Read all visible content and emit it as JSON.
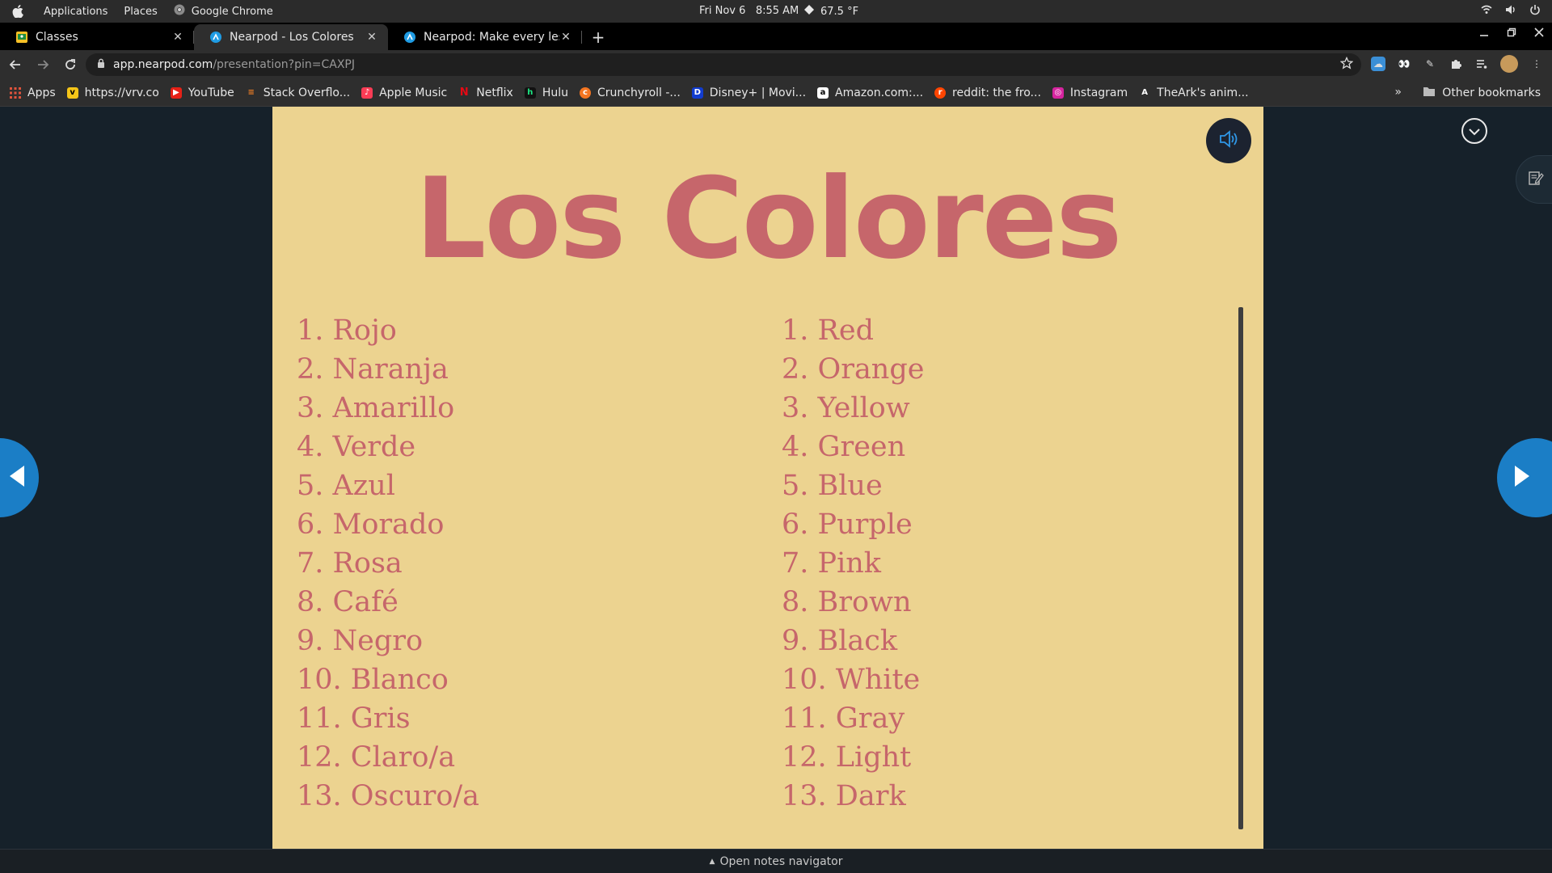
{
  "system_bar": {
    "menus": [
      "Applications",
      "Places"
    ],
    "active_app": "Google Chrome",
    "date": "Fri Nov 6",
    "time": "8:55 AM",
    "weather": "67.5 °F"
  },
  "tabs": [
    {
      "title": "Classes",
      "close": "✕",
      "favicon_color": "#f6c026"
    },
    {
      "title": "Nearpod - Los Colores",
      "close": "✕",
      "favicon_color": "#1f9ce4"
    },
    {
      "title": "Nearpod: Make every lesso",
      "close": "✕",
      "favicon_color": "#1f9ce4"
    }
  ],
  "new_tab": "+",
  "omnibox": {
    "host": "app.nearpod.com",
    "path": "/presentation?pin=CAXPJ"
  },
  "bookmarks": [
    {
      "label": "Apps",
      "icon": "apps-grid-icon",
      "color": "#e0533c"
    },
    {
      "label": "https://vrv.co",
      "icon": "vrv-icon",
      "color": "#f5c518"
    },
    {
      "label": "YouTube",
      "icon": "youtube-icon",
      "color": "#e62117"
    },
    {
      "label": "Stack Overflo...",
      "icon": "stackoverflow-icon",
      "color": "#f48024"
    },
    {
      "label": "Apple Music",
      "icon": "apple-music-icon",
      "color": "#fa3c55"
    },
    {
      "label": "Netflix",
      "icon": "netflix-icon",
      "color": "#e50914"
    },
    {
      "label": "Hulu",
      "icon": "hulu-icon",
      "color": "#1ce783"
    },
    {
      "label": "Crunchyroll -...",
      "icon": "crunchyroll-icon",
      "color": "#f47521"
    },
    {
      "label": "Disney+ | Movi...",
      "icon": "disney-icon",
      "color": "#113ccf"
    },
    {
      "label": "Amazon.com:...",
      "icon": "amazon-icon",
      "color": "#ffffff"
    },
    {
      "label": "reddit: the fro...",
      "icon": "reddit-icon",
      "color": "#ff4500"
    },
    {
      "label": "Instagram",
      "icon": "instagram-icon",
      "color": "#d6249f"
    },
    {
      "label": "TheArk's anim...",
      "icon": "theark-icon",
      "color": "#ffffff"
    }
  ],
  "bookmarks_more": "»",
  "other_bookmarks": "Other bookmarks",
  "slide": {
    "title": "Los Colores",
    "spanish": [
      "1. Rojo",
      "2. Naranja",
      "3. Amarillo",
      "4. Verde",
      "5. Azul",
      "6. Morado",
      "7. Rosa",
      "8. Café",
      "9. Negro",
      "10. Blanco",
      "11. Gris",
      "12. Claro/a",
      "13. Oscuro/a"
    ],
    "english": [
      "1. Red",
      "2. Orange",
      "3. Yellow",
      "4. Green",
      "5. Blue",
      "6. Purple",
      "7. Pink",
      "8. Brown",
      "9. Black",
      "10. White",
      "11. Gray",
      "12. Light",
      "13. Dark"
    ],
    "background": "#ecd390",
    "text_color": "#c6666b"
  },
  "footer": {
    "label": "Open notes navigator",
    "arrow": "▲"
  }
}
